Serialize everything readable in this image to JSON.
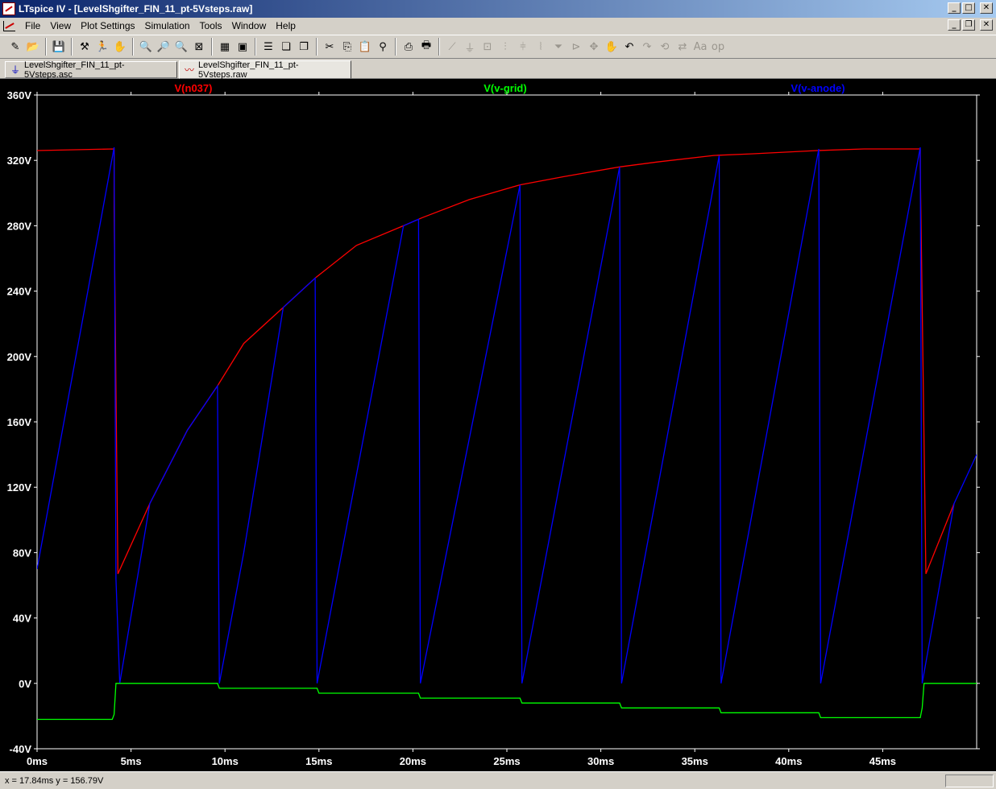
{
  "window": {
    "title": "LTspice IV - [LevelShgifter_FIN_11_pt-5Vsteps.raw]",
    "buttons": {
      "minimize": "_",
      "maximize": "□",
      "close": "✕"
    }
  },
  "menu": {
    "items": [
      "File",
      "View",
      "Plot Settings",
      "Simulation",
      "Tools",
      "Window",
      "Help"
    ],
    "mdi_buttons": {
      "minimize": "_",
      "restore": "❐",
      "close": "✕"
    }
  },
  "toolbar": {
    "buttons": [
      {
        "name": "new-schematic-icon",
        "glyph": "✎",
        "enabled": true
      },
      {
        "name": "open-icon",
        "glyph": "📂",
        "enabled": true
      },
      {
        "sep": true
      },
      {
        "name": "save-icon",
        "glyph": "💾",
        "enabled": true
      },
      {
        "sep": true
      },
      {
        "name": "control-panel-icon",
        "glyph": "⚒",
        "enabled": true
      },
      {
        "name": "run-icon",
        "glyph": "🏃",
        "enabled": true
      },
      {
        "name": "halt-icon",
        "glyph": "✋",
        "enabled": true
      },
      {
        "sep": true
      },
      {
        "name": "zoom-in-icon",
        "glyph": "🔍",
        "enabled": true
      },
      {
        "name": "zoom-pan-icon",
        "glyph": "🔎",
        "enabled": true
      },
      {
        "name": "zoom-out-icon",
        "glyph": "🔍",
        "enabled": true
      },
      {
        "name": "zoom-fit-icon",
        "glyph": "⊠",
        "enabled": true
      },
      {
        "sep": true
      },
      {
        "name": "autorange-icon",
        "glyph": "▦",
        "enabled": true
      },
      {
        "name": "waveform-cursor-icon",
        "glyph": "▣",
        "enabled": true
      },
      {
        "sep": true
      },
      {
        "name": "tile-horizontal-icon",
        "glyph": "☰",
        "enabled": true
      },
      {
        "name": "cascade-icon",
        "glyph": "❏",
        "enabled": true
      },
      {
        "name": "tile-vertical-icon",
        "glyph": "❐",
        "enabled": true
      },
      {
        "sep": true
      },
      {
        "name": "cut-icon",
        "glyph": "✂",
        "enabled": true
      },
      {
        "name": "copy-icon",
        "glyph": "⎘",
        "enabled": true
      },
      {
        "name": "paste-icon",
        "glyph": "📋",
        "enabled": true
      },
      {
        "name": "find-icon",
        "glyph": "⚲",
        "enabled": true
      },
      {
        "sep": true
      },
      {
        "name": "print-setup-icon",
        "glyph": "⎙",
        "enabled": true
      },
      {
        "name": "print-icon",
        "glyph": "🖶",
        "enabled": true
      },
      {
        "sep": true
      },
      {
        "name": "wire-icon",
        "glyph": "⟋",
        "enabled": false
      },
      {
        "name": "ground-icon",
        "glyph": "⏚",
        "enabled": false
      },
      {
        "name": "label-net-icon",
        "glyph": "⊡",
        "enabled": false
      },
      {
        "name": "resistor-icon",
        "glyph": "⫶",
        "enabled": false
      },
      {
        "name": "capacitor-icon",
        "glyph": "⫩",
        "enabled": false
      },
      {
        "name": "inductor-icon",
        "glyph": "⦚",
        "enabled": false
      },
      {
        "name": "diode-icon",
        "glyph": "⏷",
        "enabled": false
      },
      {
        "name": "component-icon",
        "glyph": "⊳",
        "enabled": false
      },
      {
        "name": "move-icon",
        "glyph": "✥",
        "enabled": false
      },
      {
        "name": "drag-icon",
        "glyph": "✋",
        "enabled": false
      },
      {
        "name": "undo-icon",
        "glyph": "↶",
        "enabled": true
      },
      {
        "name": "redo-icon",
        "glyph": "↷",
        "enabled": false
      },
      {
        "name": "rotate-icon",
        "glyph": "⟲",
        "enabled": false
      },
      {
        "name": "mirror-icon",
        "glyph": "⇄",
        "enabled": false
      },
      {
        "name": "text-icon",
        "glyph": "Aa",
        "enabled": false
      },
      {
        "name": "spice-directive-icon",
        "glyph": "op",
        "enabled": false
      }
    ]
  },
  "tabs": [
    {
      "label": "LevelShgifter_FIN_11_pt-5Vsteps.asc",
      "icon": "schematic-icon",
      "glyph": "⏚",
      "active": false
    },
    {
      "label": "LevelShgifter_FIN_11_pt-5Vsteps.raw",
      "icon": "waveform-icon",
      "glyph": "〰",
      "active": true
    }
  ],
  "colors": {
    "n037": "#ff0000",
    "vgrid": "#00ff00",
    "vanode": "#0000ff",
    "plot_bg": "#000000",
    "axis_text": "#ffffff"
  },
  "chart_data": {
    "type": "line",
    "xlabel": "",
    "ylabel": "",
    "xlim": [
      0,
      50
    ],
    "ylim": [
      -40,
      360
    ],
    "x_ticks": [
      "0ms",
      "5ms",
      "10ms",
      "15ms",
      "20ms",
      "25ms",
      "30ms",
      "35ms",
      "40ms",
      "45ms"
    ],
    "x_tick_values": [
      0,
      5,
      10,
      15,
      20,
      25,
      30,
      35,
      40,
      45
    ],
    "y_ticks": [
      "-40V",
      "0V",
      "40V",
      "80V",
      "120V",
      "160V",
      "200V",
      "240V",
      "280V",
      "320V",
      "360V"
    ],
    "y_tick_values": [
      -40,
      0,
      40,
      80,
      120,
      160,
      200,
      240,
      280,
      320,
      360
    ],
    "grid": false,
    "legend": "top",
    "series": [
      {
        "name": "V(n037)",
        "color": "#ff0000",
        "x": [
          0,
          4.1,
          4.1,
          4.3,
          6,
          8,
          9.6,
          11,
          13.1,
          14.8,
          17,
          19.5,
          20.5,
          23,
          25.7,
          28,
          31,
          33,
          36,
          38,
          41.5,
          44,
          47,
          47,
          47.3,
          48.8
        ],
        "y": [
          326,
          327,
          290,
          67,
          110,
          155,
          182,
          208,
          230,
          248,
          268,
          280,
          285,
          296,
          305,
          310,
          316,
          319,
          323,
          324,
          326,
          327,
          327,
          316,
          67,
          110
        ]
      },
      {
        "name": "V(v-grid)",
        "color": "#00ff00",
        "x": [
          0,
          4,
          4.1,
          4.2,
          9.6,
          9.7,
          14.9,
          15,
          20.3,
          20.4,
          25.7,
          25.8,
          31,
          31.1,
          36.3,
          36.4,
          41.6,
          41.7,
          47,
          47.1,
          47.2,
          50
        ],
        "y": [
          -22,
          -22,
          -19,
          0,
          0,
          -3,
          -3,
          -6,
          -6,
          -9,
          -9,
          -12,
          -12,
          -15,
          -15,
          -18,
          -18,
          -21,
          -21,
          -15,
          0,
          0
        ]
      },
      {
        "name": "V(v-anode)",
        "color": "#0000ff",
        "x": [
          0,
          4.1,
          4.2,
          4.4,
          6,
          8,
          9.6,
          9.7,
          11,
          13.1,
          14.8,
          14.9,
          19.5,
          20.3,
          20.4,
          25.7,
          25.8,
          31,
          31.1,
          36.3,
          36.4,
          41.6,
          41.7,
          47,
          47.1,
          48.8,
          50
        ],
        "y": [
          70,
          328,
          64,
          0,
          110,
          155,
          182,
          0,
          80,
          230,
          248,
          0,
          280,
          284,
          0,
          305,
          0,
          316,
          0,
          323,
          0,
          327,
          0,
          328,
          0,
          110,
          140
        ]
      }
    ]
  },
  "statusbar": {
    "cursor_text": "x = 17.84ms   y = 156.79V"
  }
}
